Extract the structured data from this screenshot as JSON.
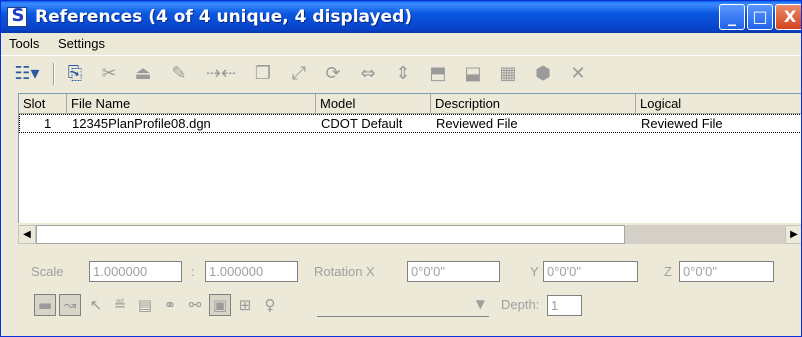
{
  "window": {
    "title": "References (4 of 4 unique, 4 displayed)"
  },
  "menu": {
    "tools": "Tools",
    "settings": "Settings"
  },
  "table": {
    "headers": [
      "Slot",
      "File Name",
      "Model",
      "Description",
      "Logical"
    ],
    "rows": [
      [
        "1",
        "12345PlanProfile08.dgn",
        "CDOT Default",
        "Reviewed File",
        "Reviewed File"
      ]
    ]
  },
  "transform": {
    "scale_label": "Scale",
    "scale_1": "1.000000",
    "scale_sep": ":",
    "scale_2": "1.000000",
    "rotation_label": "Rotation X",
    "rot_x": "0°0'0\"",
    "y_label": "Y",
    "rot_y": "0°0'0\"",
    "z_label": "Z",
    "rot_z": "0°0'0\"",
    "depth_label": "Depth:",
    "depth_value": "1",
    "level_select": ""
  },
  "colors": {
    "titlebar": "#0a57e0",
    "window_bg": "#ece9d8",
    "disabled_text": "#a0a0a0"
  },
  "icons": {
    "toolbar": [
      "display-list-icon",
      "attach-icon",
      "detach-icon",
      "reload-icon",
      "exchange-icon",
      "move-icon",
      "copy-icon",
      "scale-icon",
      "rotate-icon",
      "mirror-horizontal-icon",
      "mirror-vertical-icon",
      "clip-boundary-icon",
      "clip-mask-icon",
      "clip-delete-icon",
      "reference-settings-icon",
      "tools-icon"
    ]
  }
}
